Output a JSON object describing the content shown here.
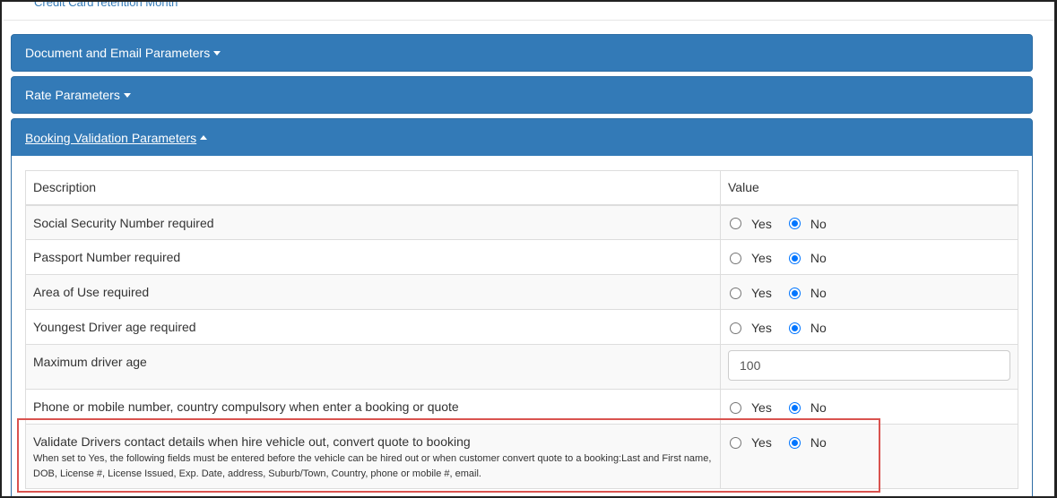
{
  "top_link": "Credit Card retention Month",
  "panels": [
    {
      "label": "Document and Email Parameters"
    },
    {
      "label": "Rate Parameters"
    },
    {
      "label": "Booking Validation Parameters"
    }
  ],
  "table": {
    "headers": [
      "Description",
      "Value"
    ],
    "rows": [
      {
        "description": "Social Security Number required",
        "yes": "Yes",
        "no": "No",
        "selected": "No"
      },
      {
        "description": "Passport Number required",
        "yes": "Yes",
        "no": "No",
        "selected": "No"
      },
      {
        "description": "Area of Use required",
        "yes": "Yes",
        "no": "No",
        "selected": "No"
      },
      {
        "description": "Youngest Driver age required",
        "yes": "Yes",
        "no": "No",
        "selected": "No"
      },
      {
        "description": "Maximum driver age",
        "value": "100"
      },
      {
        "description": "Phone or mobile number, country compulsory when enter a booking or quote",
        "yes": "Yes",
        "no": "No",
        "selected": "No"
      },
      {
        "description": "Validate Drivers contact details when hire vehicle out, convert quote to booking",
        "note": "When set to Yes, the following fields must be entered before the vehicle can be hired out or when customer convert quote to a booking:Last and First name, DOB, License #, License Issued, Exp. Date, address, Suburb/Town, Country, phone or mobile #, email.",
        "yes": "Yes",
        "no": "No",
        "selected": "No"
      }
    ]
  },
  "colors": {
    "panel": "#337ab7",
    "highlight": "#d9534f",
    "radio_checked": "#0075ff"
  }
}
